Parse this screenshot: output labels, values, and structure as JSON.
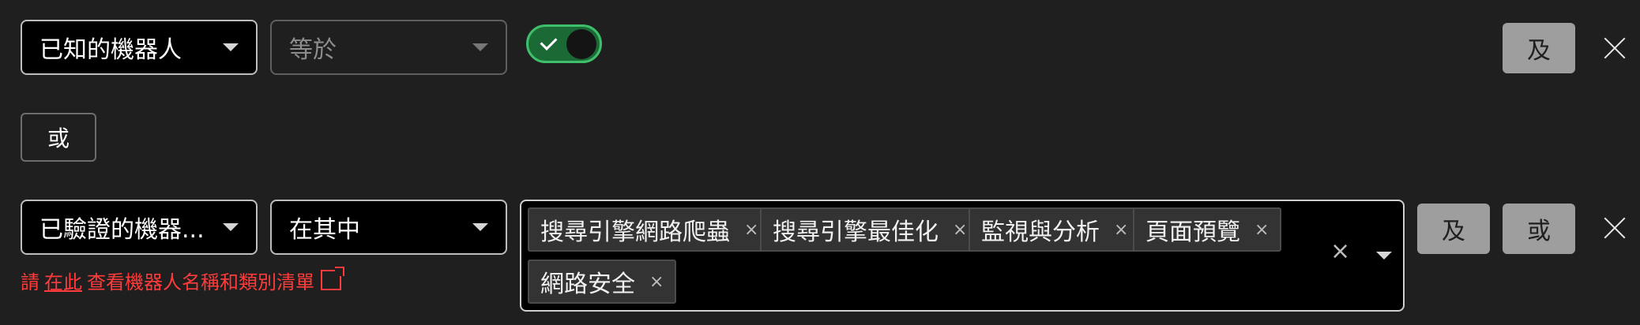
{
  "row1": {
    "field": "已知的機器人",
    "operator": "等於",
    "and_label": "及"
  },
  "or_label": "或",
  "row2": {
    "field": "已驗證的機器...",
    "operator": "在其中",
    "tags": [
      "搜尋引擎網路爬蟲",
      "搜尋引擎最佳化",
      "監視與分析",
      "頁面預覽",
      "網路安全"
    ],
    "tag_remove": "×",
    "clear": "×",
    "and_label": "及",
    "or_label": "或",
    "helper_prefix": "請",
    "helper_link": "在此",
    "helper_suffix": "查看機器人名稱和類別清單"
  },
  "colors": {
    "background": "#1f1f1f",
    "toggle_on": "#1b6a36",
    "toggle_border": "#3fbf6b",
    "helper_text": "#ff3b3b",
    "button_grey": "#9e9e9e"
  }
}
